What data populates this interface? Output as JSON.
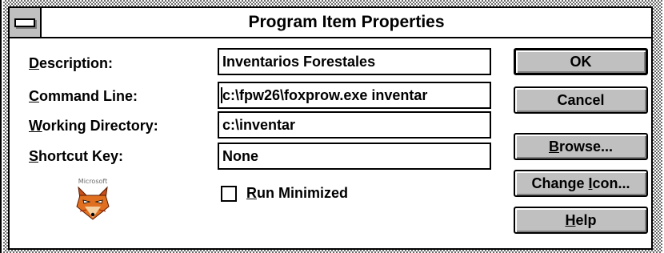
{
  "window": {
    "title": "Program Item Properties"
  },
  "form": {
    "description": {
      "label_hot": "D",
      "label_rest": "escription:",
      "value": "Inventarios Forestales"
    },
    "command_line": {
      "label_hot": "C",
      "label_rest": "ommand Line:",
      "value": "c:\\fpw26\\foxprow.exe inventar"
    },
    "working_directory": {
      "label_hot": "W",
      "label_rest": "orking Directory:",
      "value": "c:\\inventar"
    },
    "shortcut_key": {
      "label_hot": "S",
      "label_rest": "hortcut Key:",
      "value": "None"
    }
  },
  "run_minimized": {
    "label_hot": "R",
    "label_rest": "un Minimized",
    "checked": false
  },
  "icon": {
    "name": "foxpro-fox-icon",
    "caption": "Microsoft"
  },
  "buttons": {
    "ok": {
      "label": "OK"
    },
    "cancel": {
      "label": "Cancel"
    },
    "browse": {
      "hot": "B",
      "rest": "rowse..."
    },
    "change_icon": {
      "pre": "Change ",
      "hot": "I",
      "rest": "con..."
    },
    "help": {
      "hot": "H",
      "rest": "elp"
    }
  }
}
